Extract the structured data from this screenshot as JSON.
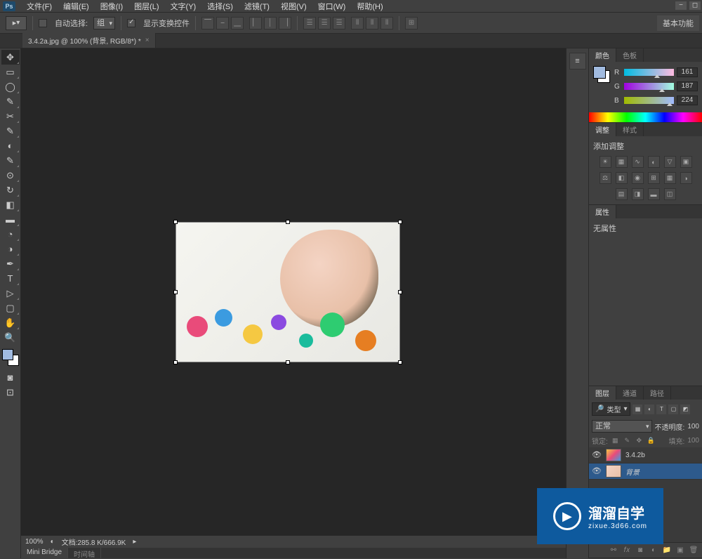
{
  "app": {
    "logo": "Ps"
  },
  "menu": {
    "file": "文件(F)",
    "edit": "编辑(E)",
    "image": "图像(I)",
    "layer": "图层(L)",
    "text": "文字(Y)",
    "select": "选择(S)",
    "filter": "滤镜(T)",
    "view": "视图(V)",
    "window": "窗口(W)",
    "help": "帮助(H)"
  },
  "options": {
    "auto_select": "自动选择:",
    "group": "组",
    "show_transform": "显示变换控件",
    "basic_func": "基本功能"
  },
  "tab": {
    "title": "3.4.2a.jpg @ 100% (背景, RGB/8*) *"
  },
  "status": {
    "zoom": "100%",
    "doc": "文档:285.8 K/666.9K"
  },
  "bottom_tabs": {
    "mini_bridge": "Mini Bridge",
    "timeline": "时间轴"
  },
  "color_panel": {
    "tab_color": "颜色",
    "tab_swatches": "色板",
    "r_label": "R",
    "g_label": "G",
    "b_label": "B",
    "r_val": "161",
    "g_val": "187",
    "b_val": "224"
  },
  "adjust_panel": {
    "tab_adjust": "调整",
    "tab_styles": "样式",
    "label": "添加调整"
  },
  "props_panel": {
    "tab": "属性",
    "text": "无属性"
  },
  "layers_panel": {
    "tab_layers": "图层",
    "tab_channels": "通道",
    "tab_paths": "路径",
    "kind": "类型",
    "blend": "正常",
    "opacity_label": "不透明度:",
    "opacity_val": "100",
    "lock_label": "锁定:",
    "fill_label": "填充:",
    "fill_val": "100",
    "layer1": "3.4.2b",
    "layer2": "背景"
  },
  "watermark": {
    "brand": "溜溜自学",
    "url": "zixue.3d66.com"
  }
}
